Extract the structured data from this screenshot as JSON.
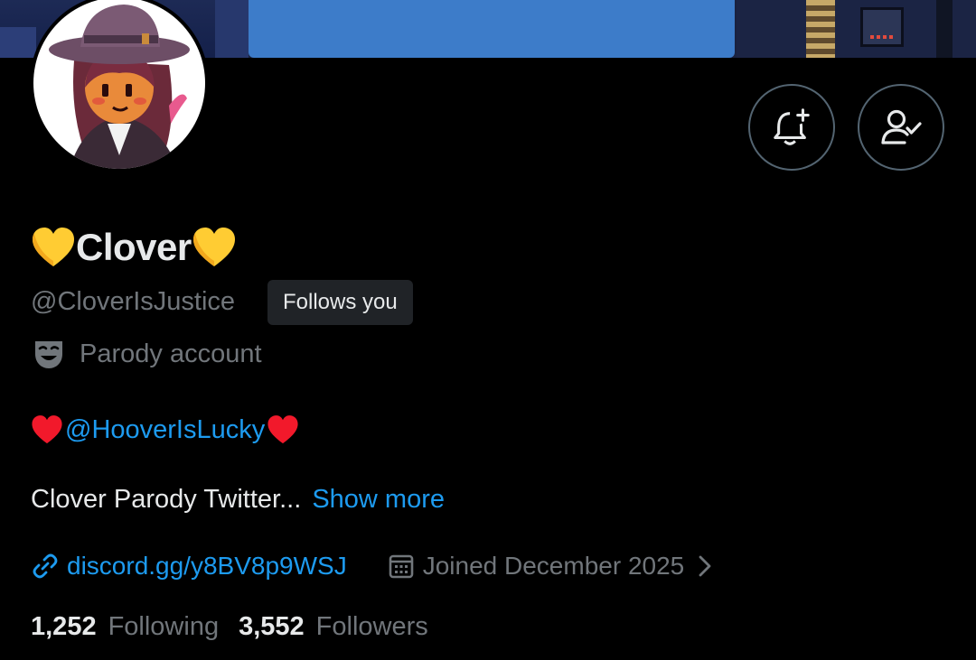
{
  "profile": {
    "display_name": "Clover",
    "handle": "@CloverIsJustice",
    "follows_you_badge": "Follows you",
    "parody_label": "Parody account",
    "bio": {
      "mention": "@HooverIsLucky",
      "text": "Clover Parody Twitter...",
      "show_more": "Show more"
    },
    "website": "discord.gg/y8BV8p9WSJ",
    "joined": "Joined December 2025",
    "stats": {
      "following_count": "1,252",
      "following_label": "Following",
      "followers_count": "3,552",
      "followers_label": "Followers"
    }
  },
  "actions": {
    "notify_icon": "bell-plus-icon",
    "following_icon": "person-check-icon"
  },
  "colors": {
    "background": "#000000",
    "primary_text": "#e7e9ea",
    "secondary_text": "#71767b",
    "accent": "#1d9bf0",
    "border": "#536471",
    "badge_bg": "#202327",
    "yellow_heart": "#ffcc33",
    "red_heart": "#f2192b"
  }
}
